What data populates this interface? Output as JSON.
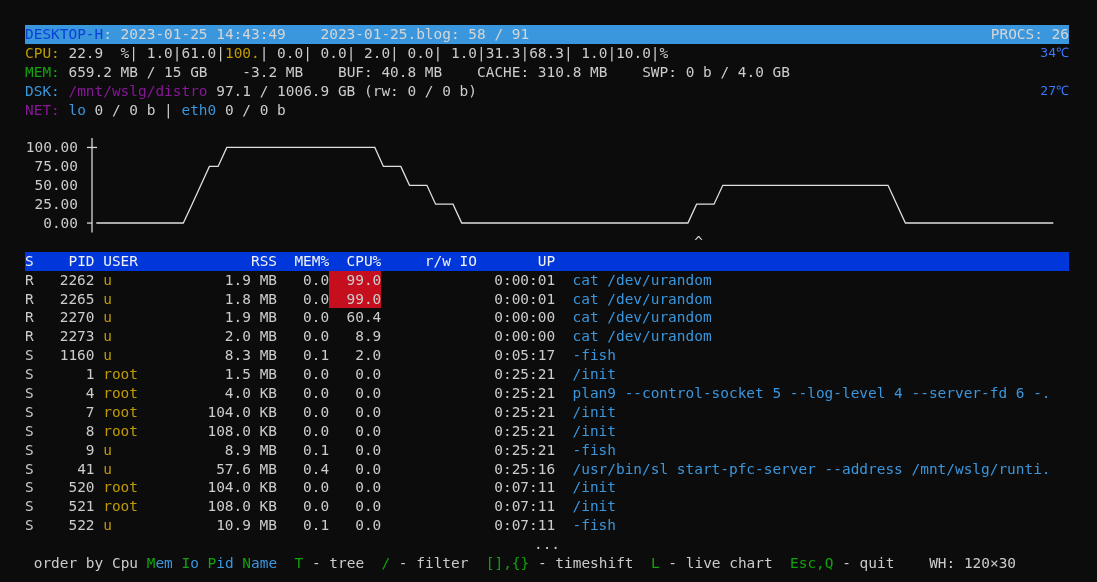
{
  "title_bar": {
    "hostname": "DESKTOP-H",
    "datetime": ": 2023-01-25 14:43:49",
    "log_file": "2023-01-25.blog: 58 / 91",
    "procs": "PROCS: 26"
  },
  "cpu": {
    "label": "CPU:",
    "segments": [
      {
        "text": "22.9  %| 1.0|61.0|",
        "high": false
      },
      {
        "text": "100.",
        "high": true
      },
      {
        "text": "| 0.0| 0.0| 2.0| 0.0| 1.0|31.3|68.3| 1.0|10.0|%",
        "high": false
      }
    ],
    "temperature": "34℃"
  },
  "mem": {
    "label": "MEM:",
    "items": [
      "659.2 MB / 15 GB",
      "-3.2 MB",
      "BUF: 40.8 MB",
      "CACHE: 310.8 MB",
      "SWP: 0 b / 4.0 GB"
    ]
  },
  "dsk": {
    "label": "DSK:",
    "mount": "/mnt/wslg/distro",
    "usage": "97.1 / 1006.9 GB (rw: 0 / 0 b)",
    "temperature": "27℃"
  },
  "net": {
    "label": "NET:",
    "separator": "|",
    "interfaces": [
      {
        "name": "lo",
        "traffic": "0 / 0 b"
      },
      {
        "name": "eth0",
        "traffic": "0 / 0 b"
      }
    ]
  },
  "chart": {
    "marker": "^",
    "chart_data": {
      "type": "line",
      "ylim": [
        -12.5,
        112.5
      ],
      "categories": [
        null,
        null,
        null,
        null,
        null,
        null,
        null,
        null,
        null,
        null,
        null,
        null,
        null,
        null,
        null,
        null,
        null,
        null,
        null,
        null,
        null,
        null,
        null,
        null,
        null,
        null,
        null,
        null,
        null,
        null,
        null,
        null,
        null,
        null,
        null,
        null,
        null,
        null,
        null,
        null,
        null,
        null,
        null,
        null,
        null,
        null,
        null,
        null,
        null,
        null,
        null,
        null,
        null,
        null,
        null,
        null,
        null,
        null,
        null,
        null,
        null,
        null,
        null,
        null,
        null,
        null,
        null,
        null,
        null,
        null,
        null,
        null,
        null,
        null,
        null,
        null,
        null,
        null,
        null,
        null,
        null,
        null,
        null,
        null,
        null,
        null,
        null,
        null,
        null,
        null,
        null,
        null,
        null,
        null,
        null,
        null,
        null,
        null,
        null,
        null,
        null,
        null,
        null,
        null,
        null,
        null,
        null,
        null,
        null,
        null,
        null
      ],
      "yticks": [
        {
          "value": 0,
          "label": "0.00"
        },
        {
          "value": 25,
          "label": "25.00"
        },
        {
          "value": 50,
          "label": "50.00"
        },
        {
          "value": 75,
          "label": "75.00"
        },
        {
          "value": 100,
          "label": "100.00"
        }
      ],
      "series": [
        {
          "color": "#e0e0e0",
          "values": [
            0,
            0,
            0,
            0,
            0,
            0,
            0,
            0,
            0,
            0,
            0,
            25,
            50,
            75,
            75,
            100,
            100,
            100,
            100,
            100,
            100,
            100,
            100,
            100,
            100,
            100,
            100,
            100,
            100,
            100,
            100,
            100,
            100,
            75,
            75,
            75,
            50,
            50,
            50,
            25,
            25,
            25,
            0,
            0,
            0,
            0,
            0,
            0,
            0,
            0,
            0,
            0,
            0,
            0,
            0,
            0,
            0,
            0,
            0,
            0,
            0,
            0,
            0,
            0,
            0,
            0,
            0,
            0,
            0,
            25,
            25,
            25,
            50,
            50,
            50,
            50,
            50,
            50,
            50,
            50,
            50,
            50,
            50,
            50,
            50,
            50,
            50,
            50,
            50,
            50,
            50,
            50,
            25,
            0,
            0,
            0,
            0,
            0,
            0,
            0,
            0,
            0,
            0,
            0,
            0,
            0,
            0,
            0,
            0,
            0,
            0
          ]
        }
      ]
    }
  },
  "table": {
    "columns": [
      "S",
      "PID",
      "USER",
      "RSS",
      "MEM%",
      "CPU%",
      "r/w IO",
      "UP"
    ],
    "rows": [
      {
        "state": "R",
        "pid": "2262",
        "user": "u",
        "rss": "1.9 MB",
        "mem": "0.0",
        "cpu": "99.0",
        "cpu_high": true,
        "up": "0:00:01",
        "command": "cat /dev/urandom"
      },
      {
        "state": "R",
        "pid": "2265",
        "user": "u",
        "rss": "1.8 MB",
        "mem": "0.0",
        "cpu": "99.0",
        "cpu_high": true,
        "up": "0:00:01",
        "command": "cat /dev/urandom"
      },
      {
        "state": "R",
        "pid": "2270",
        "user": "u",
        "rss": "1.9 MB",
        "mem": "0.0",
        "cpu": "60.4",
        "cpu_high": false,
        "up": "0:00:00",
        "command": "cat /dev/urandom"
      },
      {
        "state": "R",
        "pid": "2273",
        "user": "u",
        "rss": "2.0 MB",
        "mem": "0.0",
        "cpu": "8.9",
        "cpu_high": false,
        "up": "0:00:00",
        "command": "cat /dev/urandom"
      },
      {
        "state": "S",
        "pid": "1160",
        "user": "u",
        "rss": "8.3 MB",
        "mem": "0.1",
        "cpu": "2.0",
        "cpu_high": false,
        "up": "0:05:17",
        "command": "-fish"
      },
      {
        "state": "S",
        "pid": "1",
        "user": "root",
        "rss": "1.5 MB",
        "mem": "0.0",
        "cpu": "0.0",
        "cpu_high": false,
        "up": "0:25:21",
        "command": "/init"
      },
      {
        "state": "S",
        "pid": "4",
        "user": "root",
        "rss": "4.0 KB",
        "mem": "0.0",
        "cpu": "0.0",
        "cpu_high": false,
        "up": "0:25:21",
        "command": "plan9 --control-socket 5 --log-level 4 --server-fd 6 -."
      },
      {
        "state": "S",
        "pid": "7",
        "user": "root",
        "rss": "104.0 KB",
        "mem": "0.0",
        "cpu": "0.0",
        "cpu_high": false,
        "up": "0:25:21",
        "command": "/init"
      },
      {
        "state": "S",
        "pid": "8",
        "user": "root",
        "rss": "108.0 KB",
        "mem": "0.0",
        "cpu": "0.0",
        "cpu_high": false,
        "up": "0:25:21",
        "command": "/init"
      },
      {
        "state": "S",
        "pid": "9",
        "user": "u",
        "rss": "8.9 MB",
        "mem": "0.1",
        "cpu": "0.0",
        "cpu_high": false,
        "up": "0:25:21",
        "command": "-fish"
      },
      {
        "state": "S",
        "pid": "41",
        "user": "u",
        "rss": "57.6 MB",
        "mem": "0.4",
        "cpu": "0.0",
        "cpu_high": false,
        "up": "0:25:16",
        "command": "/usr/bin/sl start-pfc-server --address /mnt/wslg/runti."
      },
      {
        "state": "S",
        "pid": "520",
        "user": "root",
        "rss": "104.0 KB",
        "mem": "0.0",
        "cpu": "0.0",
        "cpu_high": false,
        "up": "0:07:11",
        "command": "/init"
      },
      {
        "state": "S",
        "pid": "521",
        "user": "root",
        "rss": "108.0 KB",
        "mem": "0.0",
        "cpu": "0.0",
        "cpu_high": false,
        "up": "0:07:11",
        "command": "/init"
      },
      {
        "state": "S",
        "pid": "522",
        "user": "u",
        "rss": "10.9 MB",
        "mem": "0.1",
        "cpu": "0.0",
        "cpu_high": false,
        "up": "0:07:11",
        "command": "-fish"
      }
    ],
    "more": "..."
  },
  "footer": {
    "order_label": "order by",
    "sort_options": [
      {
        "key": "C",
        "rest": "pu",
        "selected": true
      },
      {
        "key": "M",
        "rest": "em",
        "selected": false
      },
      {
        "key": "I",
        "rest": "o",
        "selected": false
      },
      {
        "key": "P",
        "rest": "id",
        "selected": false
      },
      {
        "key": "N",
        "rest": "ame",
        "selected": false
      }
    ],
    "shortcuts": [
      {
        "keys": "T",
        "action": "- tree"
      },
      {
        "keys": "/",
        "action": "- filter"
      },
      {
        "keys": "[],{}",
        "action": "- timeshift"
      },
      {
        "keys": "L",
        "action": "- live chart"
      },
      {
        "keys": "Esc,Q",
        "action": "- quit"
      }
    ],
    "size": "WH: 120×30"
  }
}
